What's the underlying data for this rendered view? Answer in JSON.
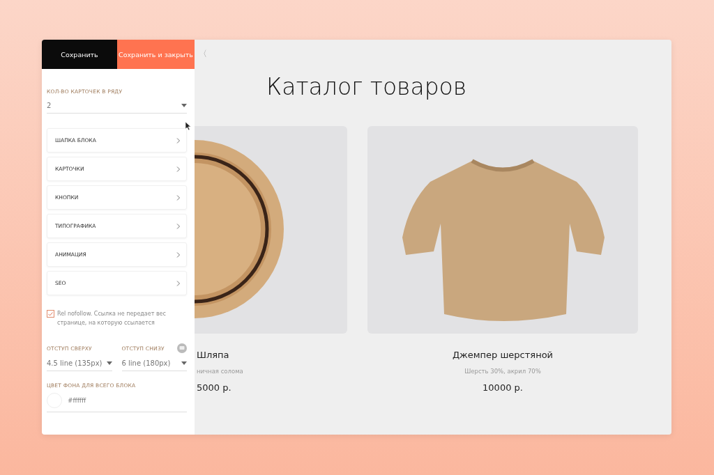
{
  "toolbar": {
    "buttons": [
      {
        "label": "Сохранить",
        "kind": "dark"
      },
      {
        "label": "Сохранить и закрыть",
        "kind": "accent"
      }
    ]
  },
  "cards_per_row": {
    "label": "КОЛ-ВО КАРТОЧЕК В РЯДУ",
    "value": "2"
  },
  "sections": [
    {
      "label": "ШАПКА БЛОКА"
    },
    {
      "label": "КАРТОЧКИ"
    },
    {
      "label": "КНОПКИ"
    },
    {
      "label": "ТИПОГРАФИКА"
    },
    {
      "label": "АНИМАЦИЯ"
    },
    {
      "label": "SEO"
    }
  ],
  "nofollow": {
    "label": "Rel nofollow. Ссылка не передает вес странице, на которую ссылается",
    "checked": true
  },
  "padding": [
    {
      "label": "ОТСТУП СВЕРХУ",
      "value": "4.5 line (135px)"
    },
    {
      "label": "ОТСТУП СНИЗУ",
      "value": "6 line (180px)"
    }
  ],
  "background": {
    "label": "ЦВЕТ ФОНА ДЛЯ ВСЕГО БЛОКА",
    "value": "#ffffff",
    "color": "#ffffff"
  },
  "preview": {
    "back": "〈",
    "title": "Каталог товаров",
    "cards": [
      {
        "kind": "hat",
        "clipped": true,
        "name": "Шляпа",
        "description": "ничная солома",
        "price": "5000 р."
      },
      {
        "kind": "sweater",
        "clipped": false,
        "name": "Джемпер шерстяной",
        "description": "Шерсть 30%, акрил 70%",
        "price": "10000 р."
      }
    ]
  }
}
